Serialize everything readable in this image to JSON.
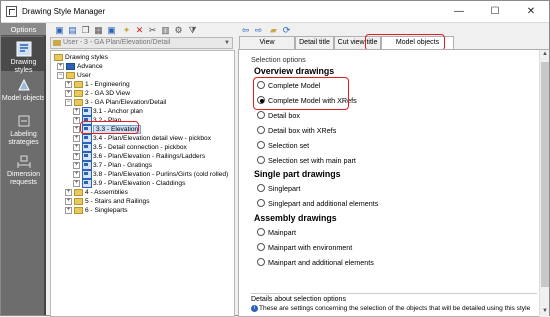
{
  "window": {
    "title": "Drawing Style Manager",
    "controls": {
      "minimize": "—",
      "maximize": "☐",
      "close": "✕"
    }
  },
  "options_bar": {
    "header": "Options",
    "items": [
      {
        "label": "Drawing styles",
        "icon": "drawing-styles-icon",
        "selected": true
      },
      {
        "label": "Model objects",
        "icon": "model-objects-icon",
        "selected": false
      },
      {
        "label": "Labeling strategies",
        "icon": "labeling-icon",
        "selected": false
      },
      {
        "label": "Dimension requests",
        "icon": "dimension-icon",
        "selected": false
      }
    ]
  },
  "toolbar": {
    "left_icons": [
      "save-icon",
      "save-as-icon",
      "copy-icon",
      "paste-icon",
      "properties-icon",
      "new-icon",
      "delete-icon",
      "cut-icon",
      "paste-2-icon",
      "settings-icon",
      "filter-icon"
    ],
    "right_icons": [
      "back-icon",
      "forward-icon",
      "folder-icon",
      "refresh-icon"
    ]
  },
  "style_selector": {
    "value": "User - 3 - GA Plan/Elevation/Detail"
  },
  "tree": {
    "root": "Drawing styles",
    "nodes": [
      {
        "label": "Drawing styles",
        "type": "folder",
        "level": 0,
        "expander": "−"
      },
      {
        "label": "Advance",
        "type": "advance",
        "level": 1,
        "expander": "+"
      },
      {
        "label": "User",
        "type": "folder",
        "level": 1,
        "expander": "−"
      },
      {
        "label": "1 - Engineering",
        "type": "folder",
        "level": 2,
        "expander": "+"
      },
      {
        "label": "2 - GA 3D View",
        "type": "folder",
        "level": 2,
        "expander": "+"
      },
      {
        "label": "3 - GA Plan/Elevation/Detail",
        "type": "folder",
        "level": 2,
        "expander": "−"
      },
      {
        "label": "3.1 - Anchor plan",
        "type": "style",
        "level": 3,
        "expander": "+"
      },
      {
        "label": "3.2 - Plan",
        "type": "style",
        "level": 3,
        "expander": "+"
      },
      {
        "label": "3.3 - Elevation",
        "type": "style",
        "level": 3,
        "expander": "+",
        "selected": true
      },
      {
        "label": "3.4 - Plan/Elevation detail view - pickbox",
        "type": "style",
        "level": 3,
        "expander": "+"
      },
      {
        "label": "3.5 - Detail connection - pickbox",
        "type": "style",
        "level": 3,
        "expander": "+"
      },
      {
        "label": "3.6 - Plan/Elevation - Railings/Ladders",
        "type": "style",
        "level": 3,
        "expander": "+"
      },
      {
        "label": "3.7 - Plan - Gratings",
        "type": "style",
        "level": 3,
        "expander": "+"
      },
      {
        "label": "3.8 - Plan/Elevation - Purlins/Girts (cold rolled)",
        "type": "style",
        "level": 3,
        "expander": "+"
      },
      {
        "label": "3.9 - Plan/Elevation - Claddings",
        "type": "style",
        "level": 3,
        "expander": "+"
      },
      {
        "label": "4 - Assemblies",
        "type": "folder",
        "level": 2,
        "expander": "+"
      },
      {
        "label": "5 - Stairs and Railings",
        "type": "folder",
        "level": 2,
        "expander": "+"
      },
      {
        "label": "6 - Singleparts",
        "type": "folder",
        "level": 2,
        "expander": "+"
      }
    ]
  },
  "tabs": [
    {
      "label": "View arrangement",
      "active": false
    },
    {
      "label": "Detail title",
      "active": false
    },
    {
      "label": "Cut view title",
      "active": false
    },
    {
      "label": "Model objects selection",
      "active": true
    }
  ],
  "selection": {
    "section_label": "Selection options",
    "overview_heading": "Overview drawings",
    "overview_options": [
      {
        "label": "Complete Model",
        "checked": false
      },
      {
        "label": "Complete Model with XRefs",
        "checked": true
      },
      {
        "label": "Detail box",
        "checked": false
      },
      {
        "label": "Detail box with XRefs",
        "checked": false
      },
      {
        "label": "Selection set",
        "checked": false
      },
      {
        "label": "Selection set with main part",
        "checked": false
      }
    ],
    "single_heading": "Single part drawings",
    "single_options": [
      {
        "label": "Singlepart",
        "checked": false
      },
      {
        "label": "Singlepart and additional elements",
        "checked": false
      }
    ],
    "assembly_heading": "Assembly drawings",
    "assembly_options": [
      {
        "label": "Mainpart",
        "checked": false
      },
      {
        "label": "Mainpart with environment",
        "checked": false
      },
      {
        "label": "Mainpart and additional elements",
        "checked": false
      }
    ]
  },
  "details": {
    "heading": "Details about selection options",
    "text": "These are settings concerning the selection of the objects that will be detailed using this style"
  },
  "colors": {
    "highlight_red": "#e0201e",
    "selection_blue": "#cfe1f7",
    "sidebar_gray": "#6d6d6d"
  }
}
